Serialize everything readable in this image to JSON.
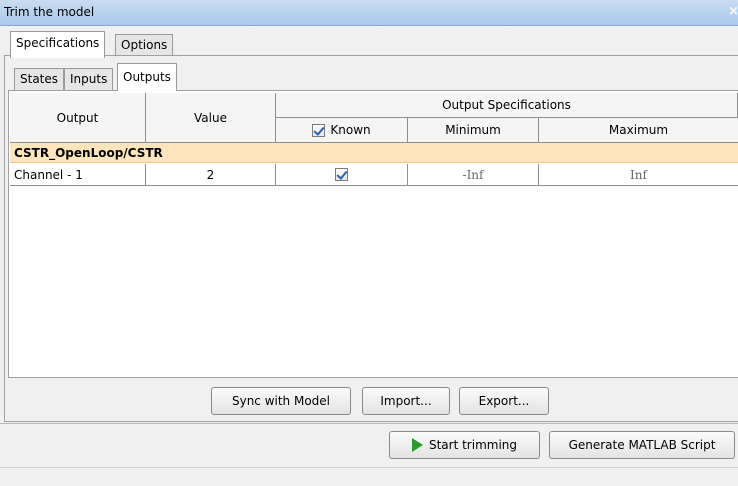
{
  "window": {
    "title": "Trim the model"
  },
  "main_tabs": {
    "specifications": "Specifications",
    "options": "Options"
  },
  "sub_tabs": {
    "states": "States",
    "inputs": "Inputs",
    "outputs": "Outputs"
  },
  "table": {
    "headers": {
      "output": "Output",
      "value": "Value",
      "output_specifications": "Output Specifications",
      "known": "Known",
      "minimum": "Minimum",
      "maximum": "Maximum"
    },
    "group": "CSTR_OpenLoop/CSTR",
    "rows": [
      {
        "output": "Channel - 1",
        "value": "2",
        "known": true,
        "minimum": "-Inf",
        "maximum": "Inf"
      }
    ]
  },
  "buttons": {
    "sync": "Sync with Model",
    "import": "Import...",
    "export": "Export...",
    "start_trimming": "Start trimming",
    "generate_script": "Generate MATLAB Script"
  },
  "icons": {
    "close": "close-icon",
    "play": "play-icon",
    "checkbox": "checkbox-checked-icon"
  },
  "colors": {
    "group_row": "#fde6bd",
    "titlebar": "#b7d1ee",
    "play_icon": "#2d9a2d"
  }
}
